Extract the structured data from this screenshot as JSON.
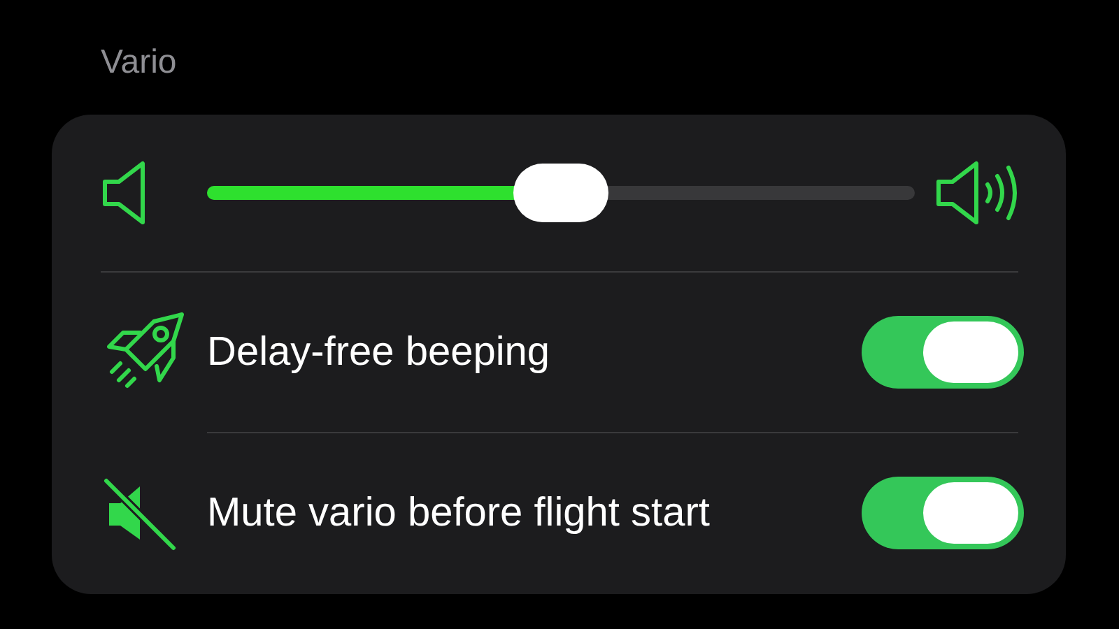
{
  "section": {
    "title": "Vario"
  },
  "volume": {
    "level": 0.5
  },
  "settings": [
    {
      "kind": "rocket",
      "label": "Delay-free beeping",
      "on": true
    },
    {
      "kind": "mute",
      "label": "Mute vario before flight start",
      "on": true
    }
  ]
}
